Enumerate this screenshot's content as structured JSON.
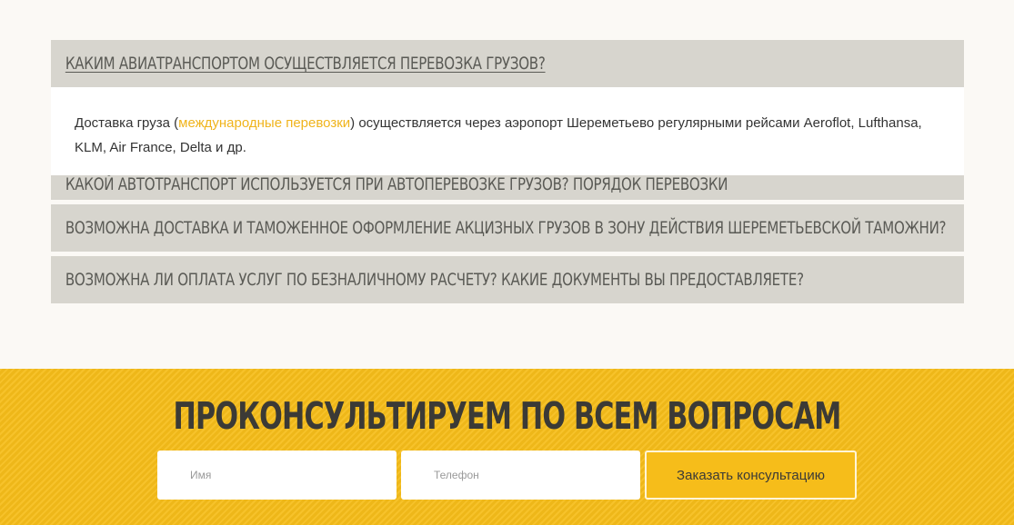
{
  "faq": {
    "items": [
      {
        "question": "КАКИМ АВИАТРАНСПОРТОМ ОСУЩЕСТВЛЯЕТСЯ ПЕРЕВОЗКА ГРУЗОВ?",
        "answer_pre": "Доставка груза (",
        "answer_link": "международные перевозки",
        "answer_post": ") осуществляется через аэропорт Шереметьево регулярными рейсами Aeroflot, Lufthansa, KLM, Air France, Delta и др."
      },
      {
        "question": "КАКОЙ АВТОТРАНСПОРТ ИСПОЛЬЗУЕТСЯ ПРИ АВТОПЕРЕВОЗКЕ ГРУЗОВ? ПОРЯДОК ПЕРЕВОЗКИ"
      },
      {
        "question": "ВОЗМОЖНА ДОСТАВКА И ТАМОЖЕННОЕ ОФОРМЛЕНИЕ АКЦИЗНЫХ ГРУЗОВ В ЗОНУ ДЕЙСТВИЯ ШЕРЕМЕТЬЕВСКОЙ ТАМОЖНИ?"
      },
      {
        "question": "ВОЗМОЖНА ЛИ ОПЛАТА УСЛУГ ПО БЕЗНАЛИЧНОМУ РАСЧЕТУ? КАКИЕ ДОКУМЕНТЫ ВЫ ПРЕДОСТАВЛЯЕТЕ?"
      }
    ]
  },
  "cta": {
    "title": "ПРОКОНСУЛЬТИРУЕМ ПО ВСЕМ ВОПРОСАМ",
    "name_placeholder": "Имя",
    "phone_placeholder": "Телефон",
    "button_label": "Заказать консультацию"
  },
  "colors": {
    "accent": "#f6bd1a",
    "link": "#f0b41c",
    "faq_bg": "#d7d5ce",
    "page_bg": "#fbf9f5"
  }
}
